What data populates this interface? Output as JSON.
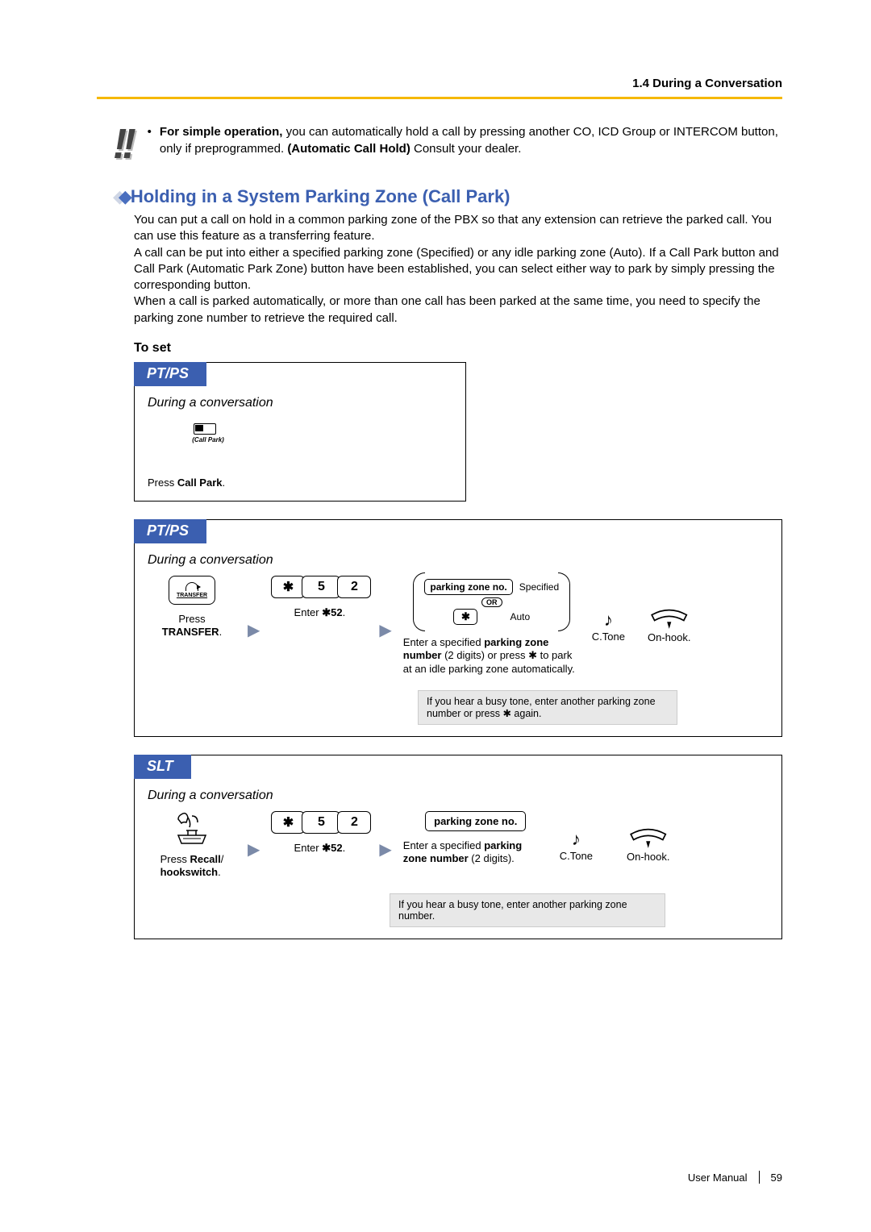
{
  "header": {
    "chapter": "1.4 During a Conversation"
  },
  "note": {
    "lead_bold": "For simple operation,",
    "lead_rest": " you can automatically hold a call by pressing another CO, ICD Group or INTERCOM button, only if preprogrammed. ",
    "auto_hold_bold": "(Automatic Call Hold)",
    "tail": " Consult your dealer."
  },
  "section": {
    "title": "Holding in a System Parking Zone (Call Park)",
    "p1": "You can put a call on hold in a common parking zone of the PBX so that any extension can retrieve the parked call. You can use this feature as a transferring feature.",
    "p2": "A call can be put into either a specified parking zone (Specified) or any idle parking zone (Auto). If a Call Park button and Call Park (Automatic Park Zone) button have been established, you can select either way to park by simply pressing the corresponding button.",
    "p3": "When a call is parked automatically, or more than one call has been parked at the same time, you need to specify the parking zone number to retrieve the required call.",
    "subhead": "To set"
  },
  "tabs": {
    "ptps": "PT/PS",
    "slt": "SLT"
  },
  "common": {
    "during": "During a conversation",
    "ctone": "C.Tone",
    "onhook": "On-hook.",
    "or": "OR",
    "star": "✱",
    "d5": "5",
    "d2": "2",
    "enter52_pre": "Enter ",
    "enter52_code": "✱52",
    "parking_zone_no": "parking zone no.",
    "specified": "Specified",
    "auto": "Auto"
  },
  "box1": {
    "callpark_label": "(Call Park)",
    "press_pre": "Press ",
    "press_bold": "Call Park",
    "press_post": "."
  },
  "box2": {
    "transfer_label": "TRANSFER",
    "press_pre": "Press ",
    "press_bold": "TRANSFER",
    "press_post": ".",
    "zone_cap_1": "Enter a specified ",
    "zone_cap_bold": "parking zone number",
    "zone_cap_2": " (2 digits) or press ✱ to park at an idle parking zone automatically.",
    "busy": "If you hear a busy tone, enter another parking zone number or press ✱ again."
  },
  "box3": {
    "press_pre": "Press ",
    "press_bold1": "Recall",
    "press_mid": "/",
    "press_bold2": "hookswitch",
    "press_post": ".",
    "zone_cap_1": "Enter a specified ",
    "zone_cap_bold": "parking zone number",
    "zone_cap_2": " (2 digits).",
    "busy": "If you hear a busy tone, enter another parking zone number."
  },
  "footer": {
    "manual": "User Manual",
    "page": "59"
  }
}
